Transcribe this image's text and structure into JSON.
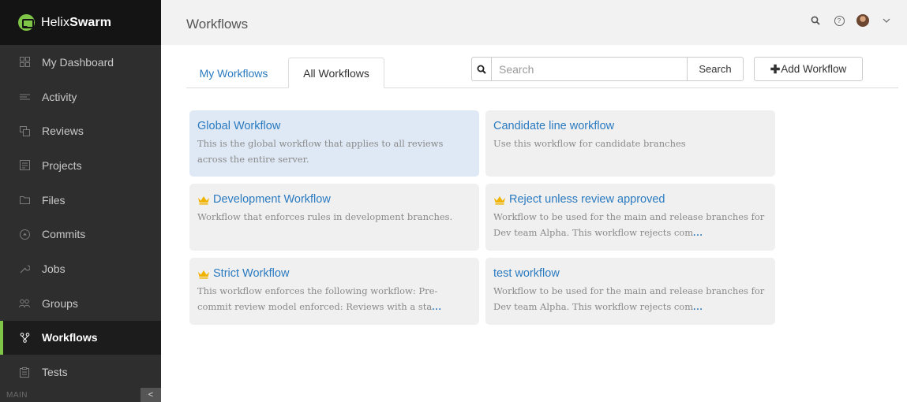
{
  "brand": {
    "name_light": "Helix",
    "name_bold": "Swarm"
  },
  "sidebar": {
    "items": [
      {
        "label": "My Dashboard",
        "icon": "dashboard-icon"
      },
      {
        "label": "Activity",
        "icon": "activity-icon"
      },
      {
        "label": "Reviews",
        "icon": "reviews-icon"
      },
      {
        "label": "Projects",
        "icon": "projects-icon"
      },
      {
        "label": "Files",
        "icon": "folder-icon"
      },
      {
        "label": "Commits",
        "icon": "commits-icon"
      },
      {
        "label": "Jobs",
        "icon": "wrench-icon"
      },
      {
        "label": "Groups",
        "icon": "groups-icon"
      },
      {
        "label": "Workflows",
        "icon": "workflow-icon",
        "active": true
      },
      {
        "label": "Tests",
        "icon": "tests-icon"
      }
    ],
    "footer_label": "MAIN",
    "collapse_glyph": "<"
  },
  "header": {
    "title": "Workflows"
  },
  "tabs": {
    "my": "My Workflows",
    "all": "All Workflows",
    "active": "all"
  },
  "search": {
    "placeholder": "Search",
    "button": "Search"
  },
  "add_button": {
    "label": "Add Workflow"
  },
  "cards": [
    {
      "title": "Global Workflow",
      "crown": false,
      "selected": true,
      "desc": "This is the global workflow that applies to all reviews across the entire server.",
      "more": ""
    },
    {
      "title": "Candidate line workflow",
      "crown": false,
      "selected": false,
      "desc": "Use this workflow for candidate branches",
      "more": ""
    },
    {
      "title": "Development Workflow",
      "crown": true,
      "selected": false,
      "desc": "Workflow that enforces rules in development branches.",
      "more": ""
    },
    {
      "title": "Reject unless review approved",
      "crown": true,
      "selected": false,
      "desc": "Workflow to be used for the main and release branches for Dev team Alpha. This workflow rejects com",
      "more": "..."
    },
    {
      "title": "Strict Workflow",
      "crown": true,
      "selected": false,
      "desc": "This workflow enforces the following workflow: Pre-commit review model enforced: Reviews with a sta",
      "more": "..."
    },
    {
      "title": "test workflow",
      "crown": false,
      "selected": false,
      "desc": "Workflow to be used for the main and release branches for Dev team Alpha. This workflow rejects com",
      "more": "..."
    }
  ],
  "colors": {
    "accent": "#2a7ac0",
    "brand_green": "#7fc548",
    "crown": "#f0b400"
  }
}
